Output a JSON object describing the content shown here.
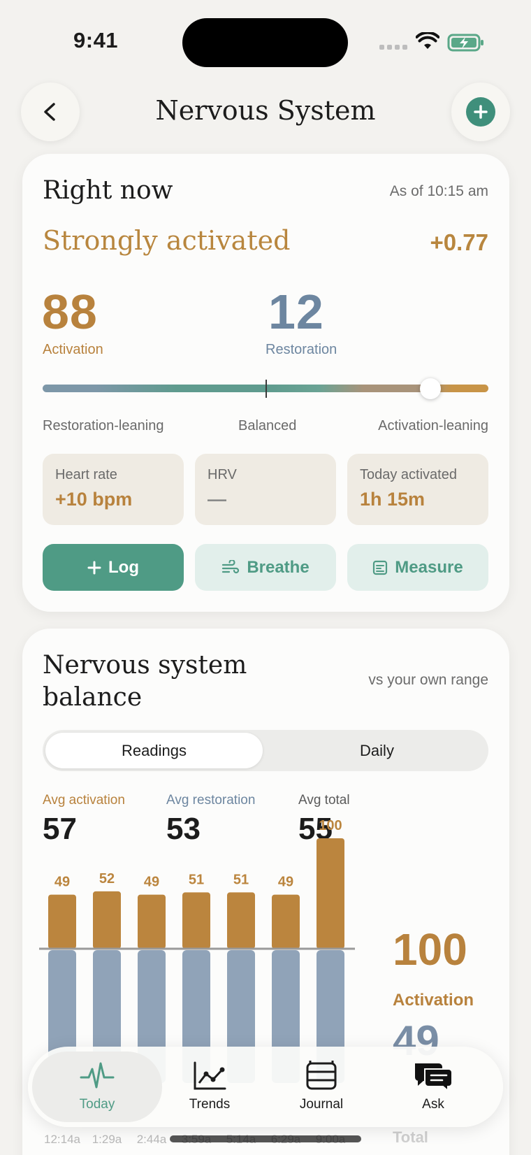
{
  "status": {
    "time": "9:41"
  },
  "header": {
    "title": "Nervous System",
    "back_icon": "chevron-left-icon",
    "add_icon": "plus-circle-icon"
  },
  "right_now": {
    "title": "Right now",
    "as_of": "As of 10:15 am",
    "state": "Strongly activated",
    "delta": "+0.77",
    "activation_value": "88",
    "activation_label": "Activation",
    "restoration_value": "12",
    "restoration_label": "Restoration",
    "balance_position": 0.87,
    "scale_labels": {
      "left": "Restoration-leaning",
      "center": "Balanced",
      "right": "Activation-leaning"
    },
    "stats": [
      {
        "label": "Heart rate",
        "value": "+10 bpm"
      },
      {
        "label": "HRV",
        "value": "—"
      },
      {
        "label": "Today activated",
        "value": "1h 15m"
      }
    ],
    "actions": {
      "log": "Log",
      "breathe": "Breathe",
      "measure": "Measure"
    }
  },
  "balance": {
    "title_line1": "Nervous system",
    "title_line2": "balance",
    "subtitle": "vs your own range",
    "segments": {
      "readings": "Readings",
      "daily": "Daily"
    },
    "averages": [
      {
        "label": "Avg activation",
        "value": "57",
        "color": "#b8823d"
      },
      {
        "label": "Avg restoration",
        "value": "53",
        "color": "#6d86a0"
      },
      {
        "label": "Avg total",
        "value": "55",
        "color": "#5a5a5a"
      }
    ],
    "selected": {
      "activation_value": "100",
      "activation_label": "Activation",
      "restoration_value": "49",
      "total_label": "Total"
    }
  },
  "chart_data": {
    "type": "bar",
    "categories": [
      "12:14a",
      "1:29a",
      "2:44a",
      "3:59a",
      "5:14a",
      "6:29a",
      "9:00a"
    ],
    "series": [
      {
        "name": "Activation",
        "values": [
          49,
          52,
          49,
          51,
          51,
          49,
          100
        ],
        "color": "#bb853e"
      },
      {
        "name": "Restoration",
        "color": "#7d93ab"
      }
    ],
    "ylim": [
      0,
      100
    ]
  },
  "tabs": [
    {
      "label": "Today",
      "icon": "heartbeat-icon",
      "active": true
    },
    {
      "label": "Trends",
      "icon": "line-chart-icon",
      "active": false
    },
    {
      "label": "Journal",
      "icon": "journal-icon",
      "active": false
    },
    {
      "label": "Ask",
      "icon": "chat-bubble-icon",
      "active": false
    }
  ],
  "colors": {
    "accent": "#4f9b85",
    "activation": "#b8823d",
    "restoration": "#6d86a0",
    "background": "#f3f2ef"
  }
}
